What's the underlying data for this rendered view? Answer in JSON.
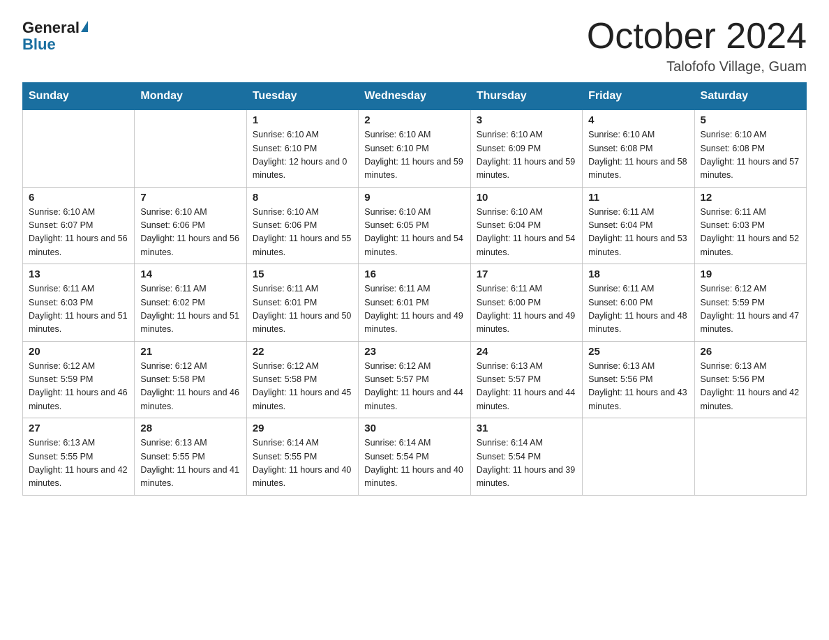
{
  "header": {
    "logo_general": "General",
    "logo_blue": "Blue",
    "title": "October 2024",
    "subtitle": "Talofofo Village, Guam"
  },
  "days_of_week": [
    "Sunday",
    "Monday",
    "Tuesday",
    "Wednesday",
    "Thursday",
    "Friday",
    "Saturday"
  ],
  "weeks": [
    [
      {
        "day": "",
        "sunrise": "",
        "sunset": "",
        "daylight": ""
      },
      {
        "day": "",
        "sunrise": "",
        "sunset": "",
        "daylight": ""
      },
      {
        "day": "1",
        "sunrise": "Sunrise: 6:10 AM",
        "sunset": "Sunset: 6:10 PM",
        "daylight": "Daylight: 12 hours and 0 minutes."
      },
      {
        "day": "2",
        "sunrise": "Sunrise: 6:10 AM",
        "sunset": "Sunset: 6:10 PM",
        "daylight": "Daylight: 11 hours and 59 minutes."
      },
      {
        "day": "3",
        "sunrise": "Sunrise: 6:10 AM",
        "sunset": "Sunset: 6:09 PM",
        "daylight": "Daylight: 11 hours and 59 minutes."
      },
      {
        "day": "4",
        "sunrise": "Sunrise: 6:10 AM",
        "sunset": "Sunset: 6:08 PM",
        "daylight": "Daylight: 11 hours and 58 minutes."
      },
      {
        "day": "5",
        "sunrise": "Sunrise: 6:10 AM",
        "sunset": "Sunset: 6:08 PM",
        "daylight": "Daylight: 11 hours and 57 minutes."
      }
    ],
    [
      {
        "day": "6",
        "sunrise": "Sunrise: 6:10 AM",
        "sunset": "Sunset: 6:07 PM",
        "daylight": "Daylight: 11 hours and 56 minutes."
      },
      {
        "day": "7",
        "sunrise": "Sunrise: 6:10 AM",
        "sunset": "Sunset: 6:06 PM",
        "daylight": "Daylight: 11 hours and 56 minutes."
      },
      {
        "day": "8",
        "sunrise": "Sunrise: 6:10 AM",
        "sunset": "Sunset: 6:06 PM",
        "daylight": "Daylight: 11 hours and 55 minutes."
      },
      {
        "day": "9",
        "sunrise": "Sunrise: 6:10 AM",
        "sunset": "Sunset: 6:05 PM",
        "daylight": "Daylight: 11 hours and 54 minutes."
      },
      {
        "day": "10",
        "sunrise": "Sunrise: 6:10 AM",
        "sunset": "Sunset: 6:04 PM",
        "daylight": "Daylight: 11 hours and 54 minutes."
      },
      {
        "day": "11",
        "sunrise": "Sunrise: 6:11 AM",
        "sunset": "Sunset: 6:04 PM",
        "daylight": "Daylight: 11 hours and 53 minutes."
      },
      {
        "day": "12",
        "sunrise": "Sunrise: 6:11 AM",
        "sunset": "Sunset: 6:03 PM",
        "daylight": "Daylight: 11 hours and 52 minutes."
      }
    ],
    [
      {
        "day": "13",
        "sunrise": "Sunrise: 6:11 AM",
        "sunset": "Sunset: 6:03 PM",
        "daylight": "Daylight: 11 hours and 51 minutes."
      },
      {
        "day": "14",
        "sunrise": "Sunrise: 6:11 AM",
        "sunset": "Sunset: 6:02 PM",
        "daylight": "Daylight: 11 hours and 51 minutes."
      },
      {
        "day": "15",
        "sunrise": "Sunrise: 6:11 AM",
        "sunset": "Sunset: 6:01 PM",
        "daylight": "Daylight: 11 hours and 50 minutes."
      },
      {
        "day": "16",
        "sunrise": "Sunrise: 6:11 AM",
        "sunset": "Sunset: 6:01 PM",
        "daylight": "Daylight: 11 hours and 49 minutes."
      },
      {
        "day": "17",
        "sunrise": "Sunrise: 6:11 AM",
        "sunset": "Sunset: 6:00 PM",
        "daylight": "Daylight: 11 hours and 49 minutes."
      },
      {
        "day": "18",
        "sunrise": "Sunrise: 6:11 AM",
        "sunset": "Sunset: 6:00 PM",
        "daylight": "Daylight: 11 hours and 48 minutes."
      },
      {
        "day": "19",
        "sunrise": "Sunrise: 6:12 AM",
        "sunset": "Sunset: 5:59 PM",
        "daylight": "Daylight: 11 hours and 47 minutes."
      }
    ],
    [
      {
        "day": "20",
        "sunrise": "Sunrise: 6:12 AM",
        "sunset": "Sunset: 5:59 PM",
        "daylight": "Daylight: 11 hours and 46 minutes."
      },
      {
        "day": "21",
        "sunrise": "Sunrise: 6:12 AM",
        "sunset": "Sunset: 5:58 PM",
        "daylight": "Daylight: 11 hours and 46 minutes."
      },
      {
        "day": "22",
        "sunrise": "Sunrise: 6:12 AM",
        "sunset": "Sunset: 5:58 PM",
        "daylight": "Daylight: 11 hours and 45 minutes."
      },
      {
        "day": "23",
        "sunrise": "Sunrise: 6:12 AM",
        "sunset": "Sunset: 5:57 PM",
        "daylight": "Daylight: 11 hours and 44 minutes."
      },
      {
        "day": "24",
        "sunrise": "Sunrise: 6:13 AM",
        "sunset": "Sunset: 5:57 PM",
        "daylight": "Daylight: 11 hours and 44 minutes."
      },
      {
        "day": "25",
        "sunrise": "Sunrise: 6:13 AM",
        "sunset": "Sunset: 5:56 PM",
        "daylight": "Daylight: 11 hours and 43 minutes."
      },
      {
        "day": "26",
        "sunrise": "Sunrise: 6:13 AM",
        "sunset": "Sunset: 5:56 PM",
        "daylight": "Daylight: 11 hours and 42 minutes."
      }
    ],
    [
      {
        "day": "27",
        "sunrise": "Sunrise: 6:13 AM",
        "sunset": "Sunset: 5:55 PM",
        "daylight": "Daylight: 11 hours and 42 minutes."
      },
      {
        "day": "28",
        "sunrise": "Sunrise: 6:13 AM",
        "sunset": "Sunset: 5:55 PM",
        "daylight": "Daylight: 11 hours and 41 minutes."
      },
      {
        "day": "29",
        "sunrise": "Sunrise: 6:14 AM",
        "sunset": "Sunset: 5:55 PM",
        "daylight": "Daylight: 11 hours and 40 minutes."
      },
      {
        "day": "30",
        "sunrise": "Sunrise: 6:14 AM",
        "sunset": "Sunset: 5:54 PM",
        "daylight": "Daylight: 11 hours and 40 minutes."
      },
      {
        "day": "31",
        "sunrise": "Sunrise: 6:14 AM",
        "sunset": "Sunset: 5:54 PM",
        "daylight": "Daylight: 11 hours and 39 minutes."
      },
      {
        "day": "",
        "sunrise": "",
        "sunset": "",
        "daylight": ""
      },
      {
        "day": "",
        "sunrise": "",
        "sunset": "",
        "daylight": ""
      }
    ]
  ]
}
